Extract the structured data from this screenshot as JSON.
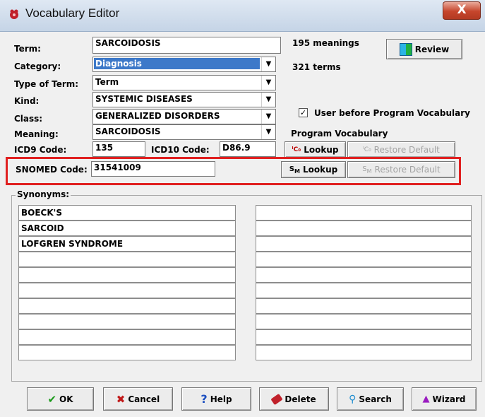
{
  "window": {
    "title": "Vocabulary Editor",
    "close_label": "X"
  },
  "form": {
    "term_label": "Term:",
    "term_value": "SARCOIDOSIS",
    "category_label": "Category:",
    "category_value": "Diagnosis",
    "type_label": "Type of Term:",
    "type_value": "Term",
    "kind_label": "Kind:",
    "kind_value": "SYSTEMIC DISEASES",
    "class_label": "Class:",
    "class_value": "GENERALIZED DISORDERS",
    "meaning_label": "Meaning:",
    "meaning_value": "SARCOIDOSIS",
    "icd9_label": "ICD9 Code:",
    "icd9_value": "135",
    "icd10_label": "ICD10 Code:",
    "icd10_value": "D86.9",
    "snomed_label": "SNOMED Code:",
    "snomed_value": "31541009"
  },
  "stats": {
    "meanings": "195 meanings",
    "terms": "321 terms"
  },
  "review_label": "Review",
  "user_before_label": "User before Program Vocabulary",
  "user_before_checked": true,
  "program_vocab_label": "Program Vocabulary",
  "icd": {
    "lookup": "Lookup",
    "restore": "Restore Default",
    "icon": "IC10-icon"
  },
  "snomed": {
    "lookup": "Lookup",
    "restore": "Restore Default",
    "icon": "SM-icon"
  },
  "synonyms": {
    "label": "Synonyms:",
    "left": [
      "BOECK'S",
      "SARCOID",
      "LOFGREN SYNDROME",
      "",
      "",
      "",
      "",
      "",
      "",
      ""
    ],
    "right": [
      "",
      "",
      "",
      "",
      "",
      "",
      "",
      "",
      "",
      ""
    ]
  },
  "buttons": {
    "ok": "OK",
    "cancel": "Cancel",
    "help": "Help",
    "delete": "Delete",
    "search": "Search",
    "wizard": "Wizard"
  },
  "colors": {
    "highlight": "#e02020",
    "selection": "#3d79c9",
    "close": "#c6452c"
  }
}
